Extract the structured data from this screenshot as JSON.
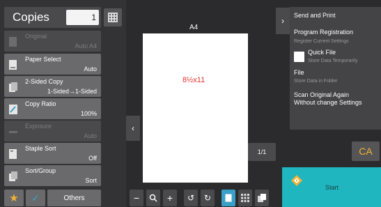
{
  "copies": {
    "label": "Copies",
    "value": "1"
  },
  "menu": [
    {
      "title": "Original",
      "value": "Auto A4",
      "enabled": false
    },
    {
      "title": "Paper Select",
      "value": "Auto",
      "enabled": true
    },
    {
      "title": "2-Sided Copy",
      "value": "1-Sided→1-Sided",
      "enabled": true
    },
    {
      "title": "Copy Ratio",
      "value": "100%",
      "enabled": true
    },
    {
      "title": "Exposure",
      "value": "Auto",
      "enabled": false
    },
    {
      "title": "Staple Sort",
      "value": "Off",
      "enabled": true
    },
    {
      "title": "Sort/Group",
      "value": "Sort",
      "enabled": true
    }
  ],
  "bottom": {
    "others_label": "Others"
  },
  "preview": {
    "paper_label": "A4",
    "paper_size_text": "8½x11",
    "page_counter": "1/1"
  },
  "right_panel": {
    "send_and_print": "Send and Print",
    "program_registration": "Program Registration",
    "register_current_settings": "Register Current Settings",
    "quick_file": "Quick File",
    "store_data_temporarily": "Store Data Temporarily",
    "file": "File",
    "store_data_in_folder": "Store Data in Folder",
    "scan_original_again": "Scan Original Again",
    "without_change_settings": "Without change Settings"
  },
  "actions": {
    "ca_label": "CA",
    "start_label": "Start"
  },
  "colors": {
    "accent_orange": "#f2b234",
    "start_teal": "#1fb6c0",
    "active_blue": "#3aa0c8",
    "paper_text_red": "#e0312c"
  }
}
